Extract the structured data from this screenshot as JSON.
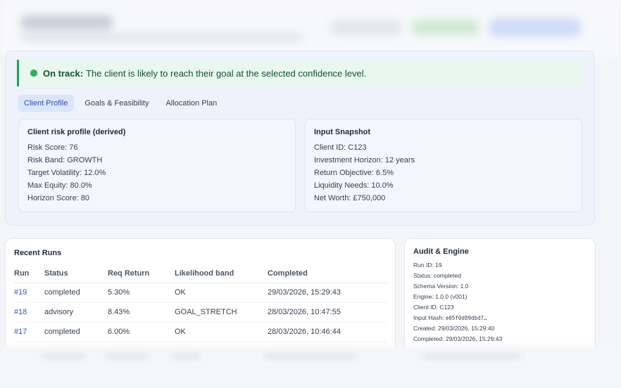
{
  "alert": {
    "strong": "On track:",
    "text": "The client is likely to reach their goal at the selected confidence level."
  },
  "tabs": [
    {
      "label": "Client Profile",
      "active": true
    },
    {
      "label": "Goals & Feasibility",
      "active": false
    },
    {
      "label": "Allocation Plan",
      "active": false
    }
  ],
  "risk_profile": {
    "title": "Client risk profile (derived)",
    "lines": [
      "Risk Score: 76",
      "Risk Band: GROWTH",
      "Target Volatility: 12.0%",
      "Max Equity: 80.0%",
      "Horizon Score: 80"
    ]
  },
  "input_snapshot": {
    "title": "Input Snapshot",
    "lines": [
      "Client ID: C123",
      "Investment Horizon: 12 years",
      "Return Objective: 6.5%",
      "Liquidity Needs: 10.0%",
      "Net Worth: £750,000"
    ]
  },
  "recent_runs": {
    "title": "Recent Runs",
    "headers": [
      "Run",
      "Status",
      "Req Return",
      "Likelihood band",
      "Completed"
    ],
    "rows": [
      [
        "#19",
        "completed",
        "5.30%",
        "OK",
        "29/03/2026, 15:29:43"
      ],
      [
        "#18",
        "advisory",
        "8.43%",
        "GOAL_STRETCH",
        "28/03/2026, 10:47:55"
      ],
      [
        "#17",
        "completed",
        "6.00%",
        "OK",
        "28/03/2026, 10:46:44"
      ]
    ]
  },
  "audit": {
    "title": "Audit & Engine",
    "run_id": "Run ID: 19",
    "status": "Status: completed",
    "schema": "Schema Version: 1.0",
    "engine": "Engine: 1.0.0 (v001)",
    "client": "Client ID: C123",
    "hash_label": "Input Hash: ",
    "hash_value": "e05f0d89dbd7…",
    "created": "Created: 29/03/2026, 15:29:40",
    "completed": "Completed: 29/03/2026, 15:29:43"
  },
  "colors": {
    "accent": "#2b4fb5",
    "success": "#22a05b",
    "link": "#3b4fc9"
  }
}
